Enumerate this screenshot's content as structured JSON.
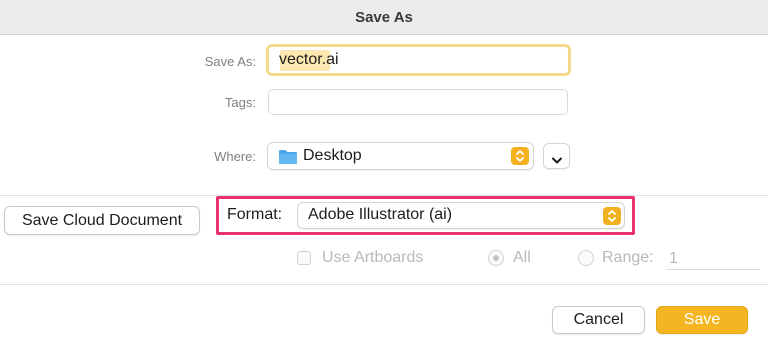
{
  "dialog": {
    "title": "Save As"
  },
  "fields": {
    "save_as_label": "Save As:",
    "filename": "vector.ai",
    "tags_label": "Tags:",
    "tags_value": "",
    "where_label": "Where:",
    "where_value": "Desktop",
    "where_icon": "folder-icon"
  },
  "cloud_button": {
    "label": "Save Cloud Document"
  },
  "format": {
    "label": "Format:",
    "value": "Adobe Illustrator (ai)"
  },
  "options": {
    "use_artboards_label": "Use Artboards",
    "use_artboards_checked": false,
    "all_label": "All",
    "all_selected": true,
    "range_label": "Range:",
    "range_value": "1"
  },
  "actions": {
    "cancel_label": "Cancel",
    "save_label": "Save"
  },
  "colors": {
    "accent": "#f3b521",
    "highlight": "#e8326c",
    "folder": "#4aa6e8"
  }
}
